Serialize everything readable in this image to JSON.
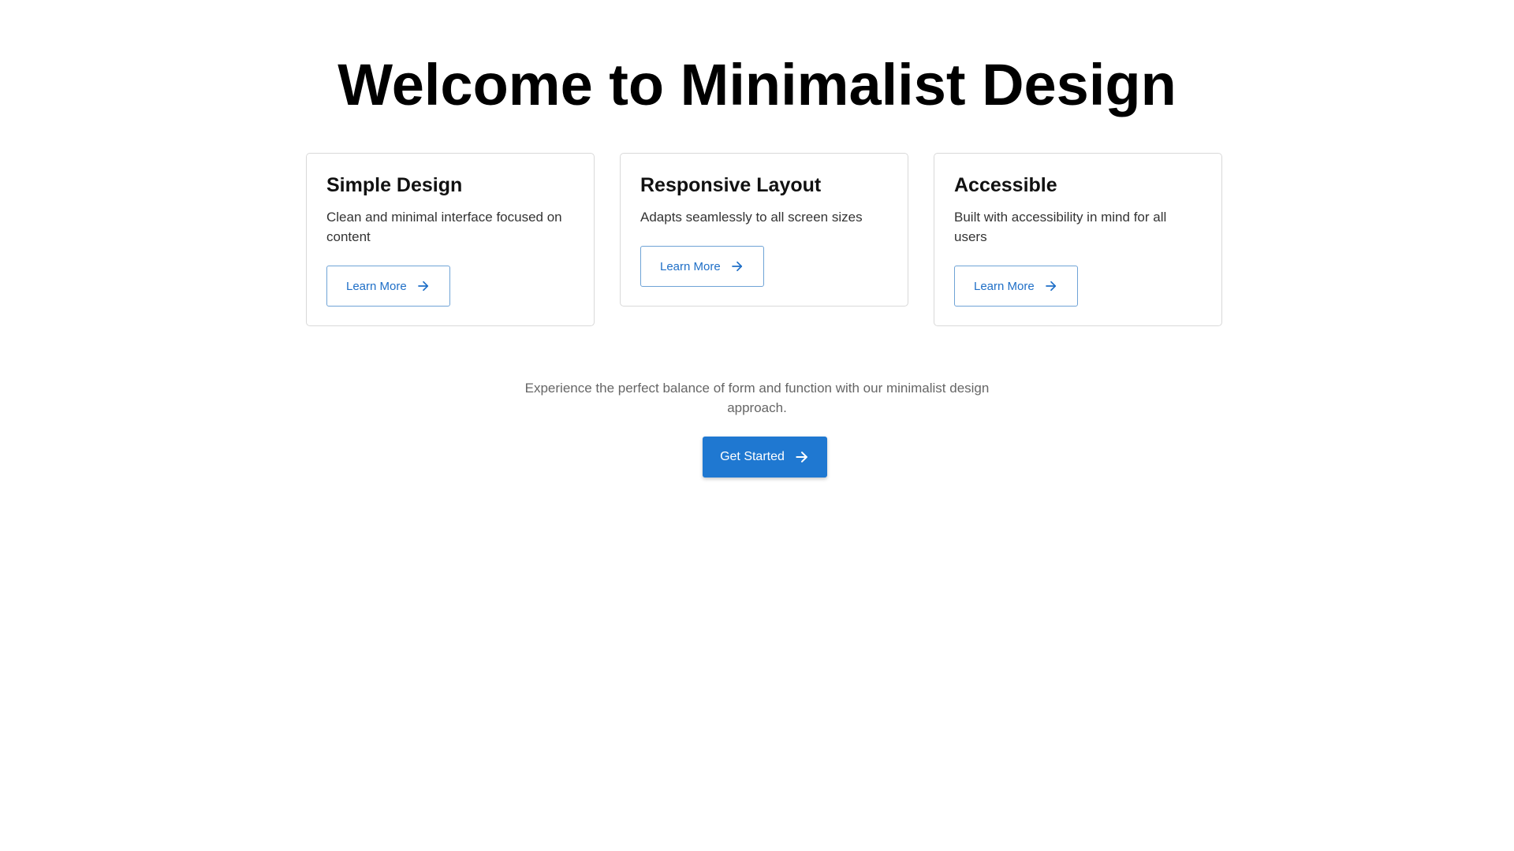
{
  "hero": {
    "title": "Welcome to Minimalist Design"
  },
  "cards": [
    {
      "title": "Simple Design",
      "description": "Clean and minimal interface focused on content",
      "button_label": "Learn More",
      "button_icon": "arrow-right-icon"
    },
    {
      "title": "Responsive Layout",
      "description": "Adapts seamlessly to all screen sizes",
      "button_label": "Learn More",
      "button_icon": "arrow-right-icon"
    },
    {
      "title": "Accessible",
      "description": "Built with accessibility in mind for all users",
      "button_label": "Learn More",
      "button_icon": "arrow-right-icon"
    }
  ],
  "cta": {
    "tagline": "Experience the perfect balance of form and function with our minimalist design approach.",
    "button_label": "Get Started",
    "button_icon": "arrow-right-icon"
  },
  "colors": {
    "accent": "#1f78d1",
    "outline_button_border": "#6fa3d6",
    "outline_button_text": "#1f6fc7",
    "card_border": "#d9d9d9",
    "muted_text": "#666666"
  }
}
